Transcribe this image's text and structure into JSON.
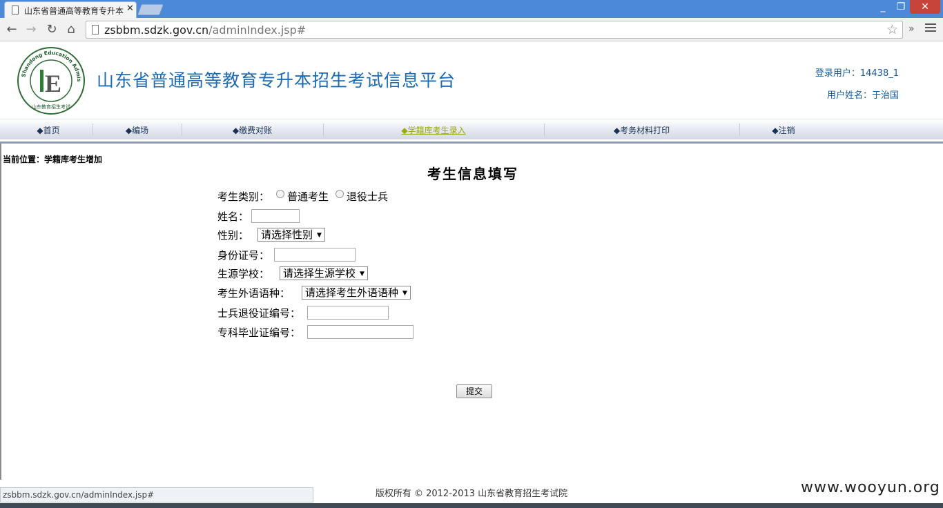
{
  "browser": {
    "tab_title": "山东省普通高等教育专升本",
    "tab_close": "✕",
    "url_domain": "zsbbm.sdzk.gov.cn",
    "url_path": "/adminIndex.jsp#",
    "back_glyph": "←",
    "forward_glyph": "→",
    "reload_glyph": "↻",
    "home_glyph": "⌂",
    "star_glyph": "☆",
    "more_glyph": "»",
    "minimize_glyph": "_",
    "maximize_glyph": "❐",
    "close_glyph": "✕"
  },
  "header": {
    "site_title": "山东省普通高等教育专升本招生考试信息平台",
    "login_user": "登录用户：14438_1",
    "user_name": "用户姓名：于治国",
    "logo_icon": "sdzk-logo-icon",
    "logo_letter": "E",
    "logo_ring_text": "Shandong Education Admissions & Examinations",
    "logo_bottom_text": "山东教育招生考试"
  },
  "nav": {
    "items": [
      {
        "label": "◆首页"
      },
      {
        "label": "◆编场"
      },
      {
        "label": "◆缴费对账"
      },
      {
        "label": "◆学籍库考生录入"
      },
      {
        "label": "◆考务材料打印"
      },
      {
        "label": "◆注销"
      }
    ],
    "active_index": 3,
    "active_color": "#9ca80f"
  },
  "content": {
    "breadcrumb": "当前位置：学籍库考生增加",
    "form_title": "考生信息填写",
    "fields": {
      "category_label": "考生类别：",
      "category_option_1": "普通考生",
      "category_option_2": "退役士兵",
      "name_label": "姓名：",
      "gender_label": "性别：",
      "gender_value": "请选择性别",
      "id_label": "身份证号：",
      "school_label": "生源学校：",
      "school_value": "请选择生源学校",
      "language_label": "考生外语语种：",
      "language_value": "请选择考生外语语种",
      "veteran_cert_label": "士兵退役证编号：",
      "diploma_label": "专科毕业证编号："
    },
    "select_arrow": "▼",
    "submit_label": "提交"
  },
  "status_bar": "zsbbm.sdzk.gov.cn/adminIndex.jsp#",
  "footer": "版权所有 © 2012-2013 山东省教育招生考试院",
  "watermark": "www.wooyun.org"
}
